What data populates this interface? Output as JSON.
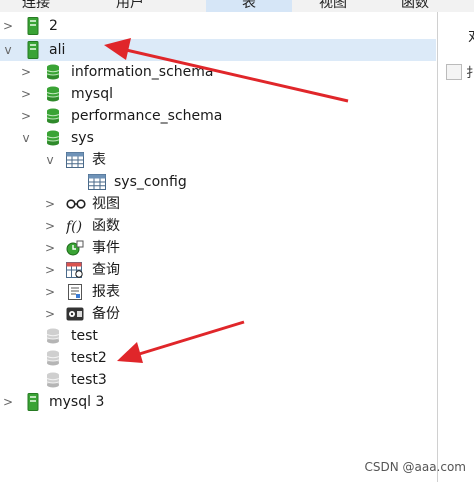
{
  "toolbar": {
    "tabs": [
      {
        "label": "连接"
      },
      {
        "label": "用户"
      },
      {
        "label": "表"
      },
      {
        "label": "视图"
      },
      {
        "label": "函数"
      }
    ]
  },
  "tree": {
    "conn_2": "2",
    "conn_ali": "ali",
    "db_information_schema": "information_schema",
    "db_mysql": "mysql",
    "db_performance_schema": "performance_schema",
    "db_sys": "sys",
    "node_tables": "表",
    "table_sys_config": "sys_config",
    "node_views": "视图",
    "node_functions": "函数",
    "node_events": "事件",
    "node_queries": "查询",
    "node_reports": "报表",
    "node_backups": "备份",
    "db_test": "test",
    "db_test2": "test2",
    "db_test3": "test3",
    "conn_mysql3": "mysql 3"
  },
  "right_panel": {
    "char": "对",
    "char2": "扌"
  },
  "watermark": "CSDN @aaa.com",
  "colors": {
    "accent": "#d6e6f7",
    "selected": "#dceaf8",
    "db_green": "#3aa335",
    "arrow_red": "#e0262a"
  }
}
